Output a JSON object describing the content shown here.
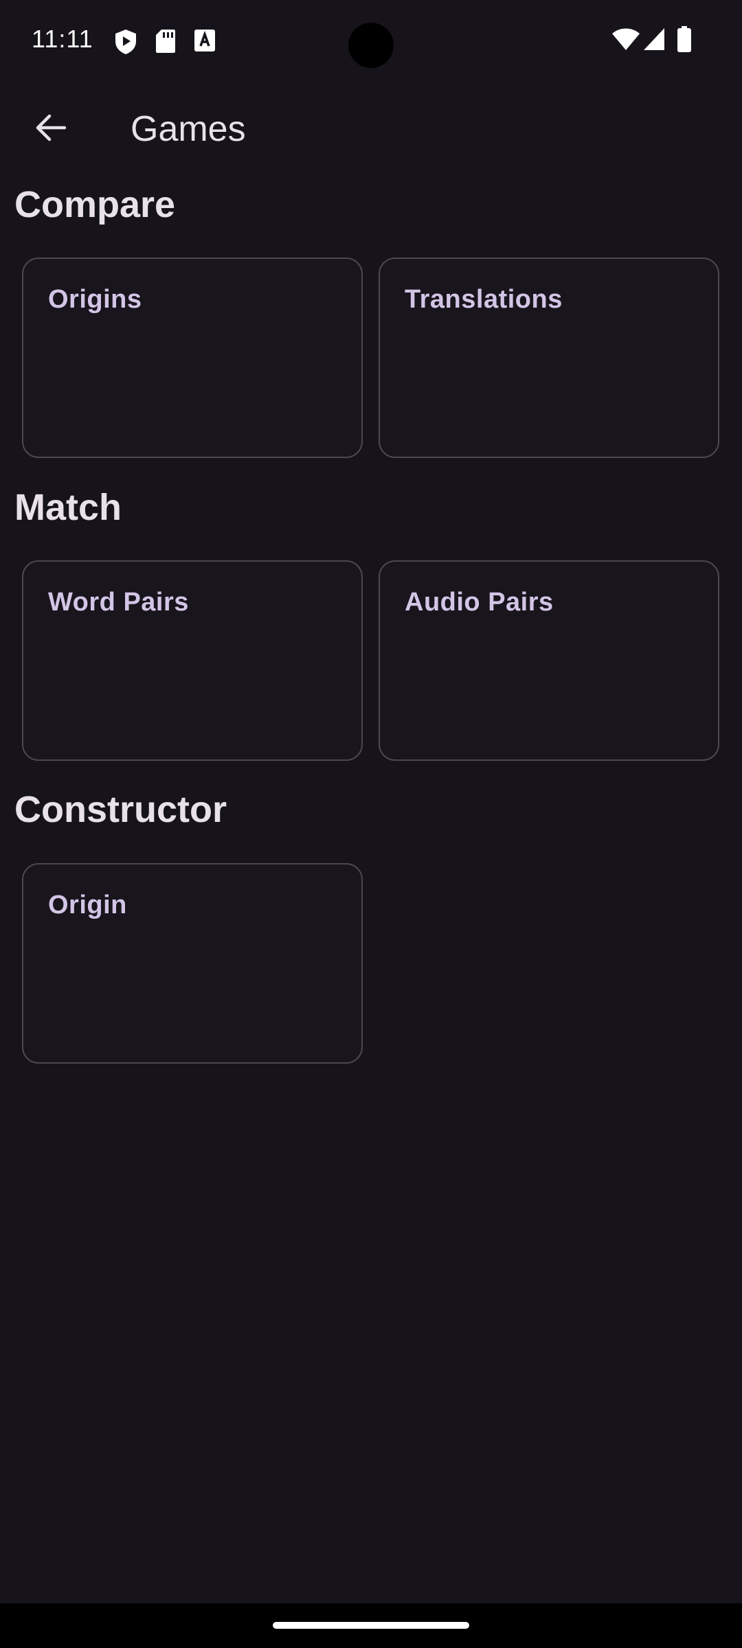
{
  "status_bar": {
    "time": "11:11",
    "left_icons": [
      "shield-play-icon",
      "sd-card-icon",
      "font-a-icon"
    ],
    "right_icons": [
      "wifi-icon",
      "signal-icon",
      "battery-icon"
    ]
  },
  "app_bar": {
    "back_icon": "arrow-back-icon",
    "title": "Games"
  },
  "sections": [
    {
      "title": "Compare",
      "cards": [
        "Origins",
        "Translations"
      ]
    },
    {
      "title": "Match",
      "cards": [
        "Word Pairs",
        "Audio Pairs"
      ]
    },
    {
      "title": "Constructor",
      "cards": [
        "Origin"
      ]
    }
  ],
  "colors": {
    "background": "#16131b",
    "card_border": "#4c4753",
    "card_label": "#d3c5e6",
    "text_primary": "#e8e1ea"
  }
}
